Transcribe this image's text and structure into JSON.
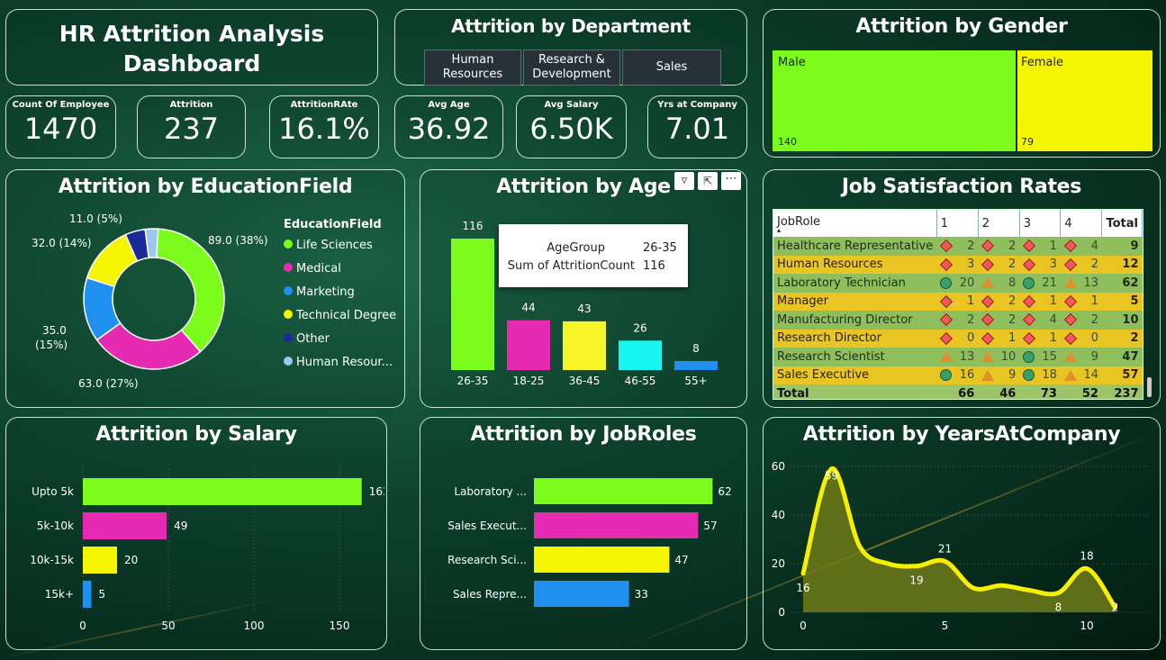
{
  "header": {
    "title_line1": "HR Attrition Analysis",
    "title_line2": "Dashboard"
  },
  "kpis": [
    {
      "label": "Count Of Employee",
      "value": "1470"
    },
    {
      "label": "Attrition",
      "value": "237"
    },
    {
      "label": "AttritionRAte",
      "value": "16.1%"
    },
    {
      "label": "Avg Age",
      "value": "36.92"
    },
    {
      "label": "Avg Salary",
      "value": "6.50K"
    },
    {
      "label": "Yrs at Company",
      "value": "7.01"
    }
  ],
  "department": {
    "title": "Attrition by Department",
    "buttons": [
      "Human Resources",
      "Research & Development",
      "Sales"
    ]
  },
  "gender": {
    "title": "Attrition by Gender",
    "male_label": "Male",
    "male_value": "140",
    "female_label": "Female",
    "female_value": "79",
    "colors": {
      "male": "#7cfc1c",
      "female": "#f5f500"
    }
  },
  "education": {
    "title": "Attrition by EducationField",
    "legend_title": "EducationField",
    "labels": {
      "life": "89.0 (38%)",
      "medical": "63.0 (27%)",
      "marketing_1": "35.0",
      "marketing_2": "(15%)",
      "technical": "32.0 (14%)",
      "other": "11.0 (5%)"
    },
    "legend": [
      "Life Sciences",
      "Medical",
      "Marketing",
      "Technical Degree",
      "Other",
      "Human Resour..."
    ]
  },
  "age": {
    "title": "Attrition by Age",
    "tooltip": {
      "k1": "AgeGroup",
      "v1": "26-35",
      "k2": "Sum of AttritionCount",
      "v2": "116"
    }
  },
  "job_satisfaction": {
    "title": "Job Satisfaction Rates",
    "headers": [
      "JobRole",
      "1",
      "2",
      "3",
      "4",
      "Total"
    ],
    "rows": [
      {
        "role": "Healthcare Representative",
        "v": [
          "2",
          "2",
          "1",
          "4"
        ],
        "i": [
          "d",
          "d",
          "d",
          "d"
        ],
        "total": "9"
      },
      {
        "role": "Human Resources",
        "v": [
          "3",
          "2",
          "3",
          "2"
        ],
        "i": [
          "d",
          "d",
          "d",
          "d"
        ],
        "total": "12"
      },
      {
        "role": "Laboratory Technician",
        "v": [
          "20",
          "8",
          "21",
          "13"
        ],
        "i": [
          "c",
          "t",
          "c",
          "t"
        ],
        "total": "62"
      },
      {
        "role": "Manager",
        "v": [
          "1",
          "2",
          "1",
          "1"
        ],
        "i": [
          "d",
          "d",
          "d",
          "d"
        ],
        "total": "5"
      },
      {
        "role": "Manufacturing Director",
        "v": [
          "2",
          "2",
          "4",
          "2"
        ],
        "i": [
          "d",
          "d",
          "d",
          "d"
        ],
        "total": "10"
      },
      {
        "role": "Research Director",
        "v": [
          "0",
          "1",
          "1",
          "0"
        ],
        "i": [
          "d",
          "d",
          "d",
          "d"
        ],
        "total": "2"
      },
      {
        "role": "Research Scientist",
        "v": [
          "13",
          "10",
          "15",
          "9"
        ],
        "i": [
          "t",
          "t",
          "c",
          "t"
        ],
        "total": "47"
      },
      {
        "role": "Sales Executive",
        "v": [
          "16",
          "9",
          "18",
          "14"
        ],
        "i": [
          "c",
          "t",
          "c",
          "t"
        ],
        "total": "57"
      }
    ],
    "total_row": {
      "label": "Total",
      "v": [
        "66",
        "46",
        "73",
        "52"
      ],
      "total": "237"
    }
  },
  "salary": {
    "title": "Attrition by Salary"
  },
  "jobroles": {
    "title": "Attrition by JobRoles"
  },
  "years": {
    "title": "Attrition by YearsAtCompany"
  },
  "chart_data": [
    {
      "type": "pie",
      "title": "Attrition by EducationField",
      "categories": [
        "Life Sciences",
        "Medical",
        "Marketing",
        "Technical Degree",
        "Other",
        "Human Resources"
      ],
      "values": [
        89,
        63,
        35,
        32,
        11,
        7
      ],
      "colors": [
        "#7cfc1c",
        "#e62ab2",
        "#1f8ff0",
        "#f5f500",
        "#1a2a99",
        "#9cc8f0"
      ],
      "legend": "right"
    },
    {
      "type": "bar",
      "title": "Attrition by Age",
      "categories": [
        "26-35",
        "18-25",
        "36-45",
        "46-55",
        "55+"
      ],
      "values": [
        116,
        44,
        43,
        26,
        8
      ],
      "colors": [
        "#7cfc1c",
        "#e62ab2",
        "#f5f528",
        "#19f5f0",
        "#1f8ff0"
      ]
    },
    {
      "type": "bar",
      "orientation": "horizontal",
      "title": "Attrition by Salary",
      "categories": [
        "Upto 5k",
        "5k-10k",
        "10k-15k",
        "15k+"
      ],
      "values": [
        163,
        49,
        20,
        5
      ],
      "colors": [
        "#7cfc1c",
        "#e62ab2",
        "#f5f500",
        "#1f8ff0"
      ],
      "xlim": [
        0,
        170
      ],
      "ticks": [
        0,
        50,
        100,
        150
      ]
    },
    {
      "type": "bar",
      "orientation": "horizontal",
      "title": "Attrition by JobRoles",
      "categories": [
        "Laboratory ...",
        "Sales Execut...",
        "Research Sci...",
        "Sales Repre..."
      ],
      "values": [
        62,
        57,
        47,
        33
      ],
      "colors": [
        "#7cfc1c",
        "#e62ab2",
        "#f5f500",
        "#1f8ff0"
      ]
    },
    {
      "type": "area",
      "title": "Attrition by YearsAtCompany",
      "x": [
        0,
        1,
        2,
        3,
        4,
        5,
        6,
        7,
        8,
        9,
        10,
        11
      ],
      "y": [
        16,
        59,
        27,
        20,
        19,
        21,
        10,
        11,
        9,
        8,
        18,
        2
      ],
      "labeled_points": [
        0,
        1,
        4,
        5,
        9,
        10,
        11
      ],
      "xticks": [
        0,
        5,
        10
      ],
      "yticks": [
        0,
        20,
        40,
        60
      ],
      "ylim": [
        0,
        62
      ],
      "line_color": "#f5f000",
      "fill_color": "#6e7a18"
    }
  ]
}
